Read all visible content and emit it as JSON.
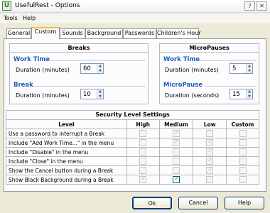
{
  "window": {
    "title": "UsefulRest - Options",
    "icon_letter": "U"
  },
  "titlebar_buttons": {
    "help": "?",
    "close": "✕"
  },
  "menu": [
    "Tools",
    "Help"
  ],
  "tabs": [
    "General",
    "Custom",
    "Sounds",
    "Background",
    "Passwords",
    "Children's Hour"
  ],
  "active_tab": "Custom",
  "breaks": {
    "title": "Breaks",
    "work_time": {
      "title": "Work Time",
      "label": "Duration (minutes)",
      "value": "60"
    },
    "break": {
      "title": "Break",
      "label": "Duration (minutes)",
      "value": "10"
    }
  },
  "micropauses": {
    "title": "MicroPauses",
    "work_time": {
      "title": "Work Time",
      "label": "Duration (minutes)",
      "value": "5"
    },
    "micropause": {
      "title": "MicroPause",
      "label": "Duration (seconds)",
      "value": "15"
    }
  },
  "security": {
    "title": "Security Level Settings",
    "columns": [
      "Level",
      "High",
      "Medium",
      "Low",
      "Custom"
    ],
    "rows": [
      {
        "label": "Use a password to interrupt a Break",
        "high": false,
        "medium": true,
        "low": false,
        "custom": false
      },
      {
        "label": "Include \"Add Work Time...\" in the menu",
        "high": false,
        "medium": true,
        "low": true,
        "custom": false
      },
      {
        "label": "Include \"Disable\" in the menu",
        "high": false,
        "medium": false,
        "low": true,
        "custom": false
      },
      {
        "label": "Include \"Close\" in the menu",
        "high": false,
        "medium": false,
        "low": true,
        "custom": false
      },
      {
        "label": "Show the Cancel button during a Break",
        "high": false,
        "medium": false,
        "low": true,
        "custom": false
      },
      {
        "label": "Show Black Background during a Break",
        "high": true,
        "medium": true,
        "low": false,
        "custom": false
      }
    ],
    "enabled_cells": [
      [
        5,
        "medium"
      ]
    ]
  },
  "buttons": {
    "ok": "Ok",
    "cancel": "Cancel",
    "help": "Help"
  },
  "colors": {
    "accent_blue": "#1f5fb8",
    "tab_highlight": "#f4b84a",
    "check_green": "#21a121"
  }
}
